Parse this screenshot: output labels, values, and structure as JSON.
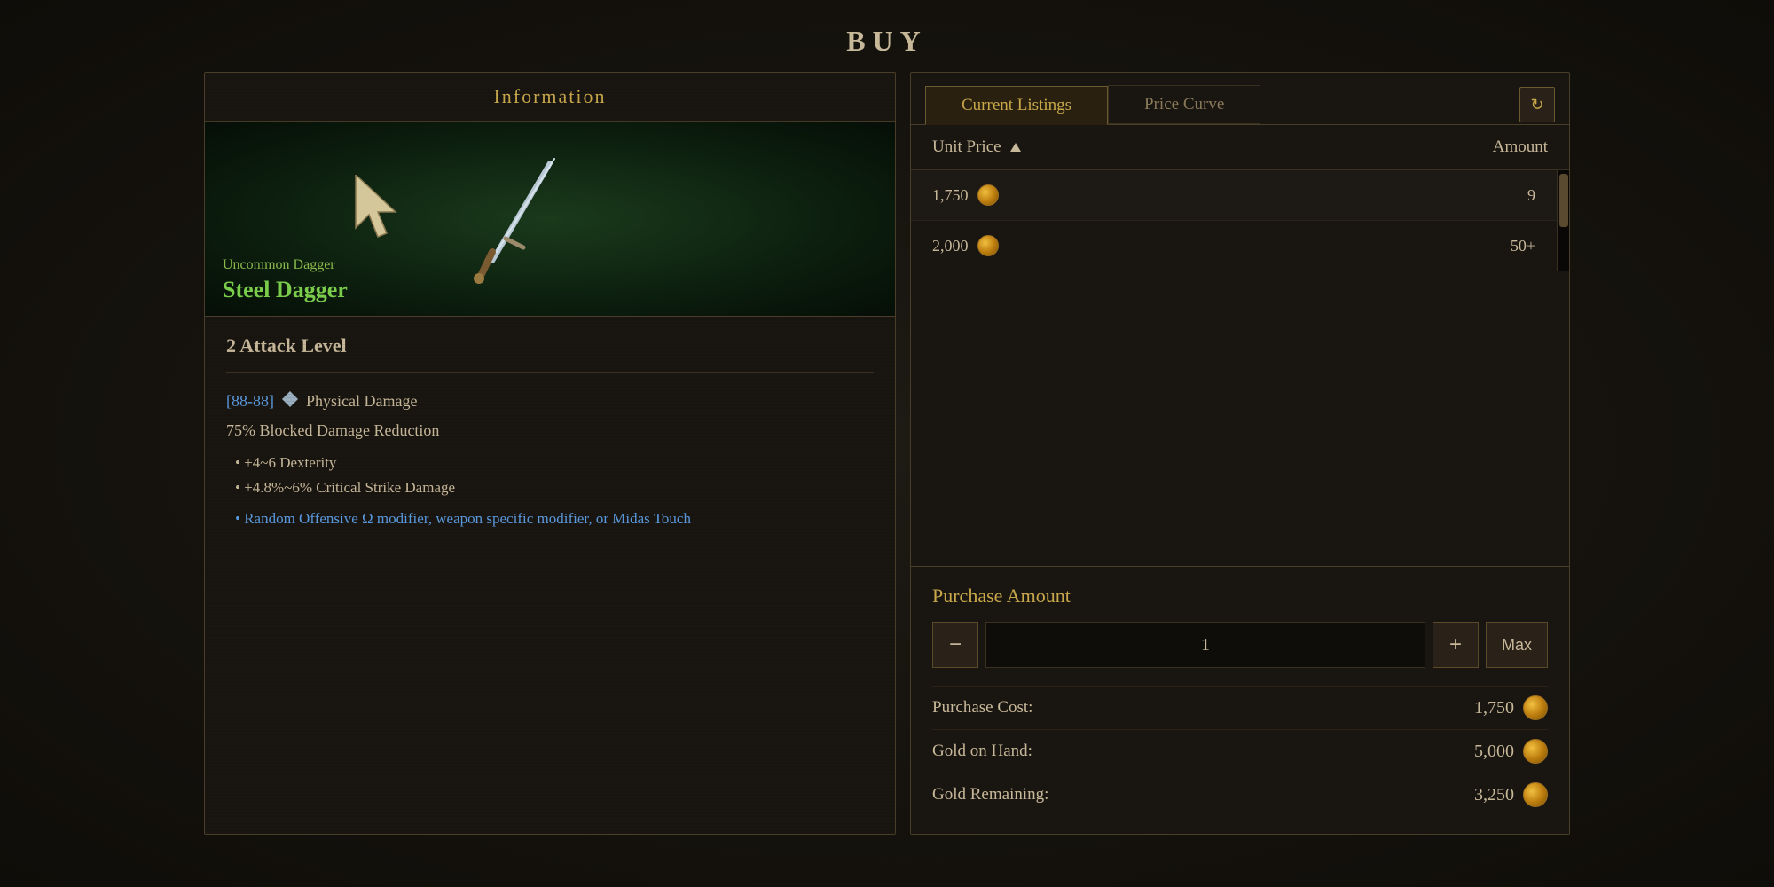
{
  "page": {
    "title": "BUY"
  },
  "info_panel": {
    "header": "Information",
    "item": {
      "type": "Uncommon Dagger",
      "name": "Steel Dagger",
      "attack_level_label": "2 Attack Level",
      "damage_range": "[88-88]",
      "damage_type": "Physical Damage",
      "blocked_damage": "75% Blocked Damage Reduction",
      "stats": [
        "+4~6 Dexterity",
        "+4.8%~6% Critical Strike Damage"
      ],
      "magic_modifier": "Random Offensive Ω modifier, weapon specific modifier, or Midas Touch"
    }
  },
  "right_panel": {
    "tabs": [
      {
        "label": "Current Listings",
        "active": true
      },
      {
        "label": "Price Curve",
        "active": false
      }
    ],
    "refresh_icon": "↻",
    "listings_header": {
      "price_col": "Unit Price",
      "amount_col": "Amount"
    },
    "listings": [
      {
        "price": "1,750",
        "amount": "9"
      },
      {
        "price": "2,000",
        "amount": "50+"
      }
    ],
    "purchase": {
      "title": "Purchase Amount",
      "quantity": "1",
      "minus_label": "−",
      "plus_label": "+",
      "max_label": "Max",
      "cost_rows": [
        {
          "label": "Purchase Cost:",
          "value": "1,750"
        },
        {
          "label": "Gold on Hand:",
          "value": "5,000"
        },
        {
          "label": "Gold Remaining:",
          "value": "3,250"
        }
      ]
    }
  }
}
